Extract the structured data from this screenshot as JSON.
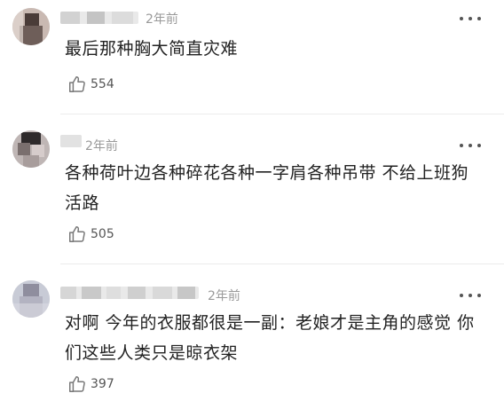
{
  "comments": [
    {
      "time": "2年前",
      "text": "最后那种胸大简直灾难",
      "likes": "554",
      "icons": {
        "like": "thumbs-up-icon",
        "more": "more-dots-icon"
      }
    },
    {
      "time": "2年前",
      "text": "各种荷叶边各种碎花各种一字肩各种吊带 不给上班狗活路",
      "likes": "505",
      "icons": {
        "like": "thumbs-up-icon",
        "more": "more-dots-icon"
      }
    },
    {
      "time": "2年前",
      "text": "对啊 今年的衣服都很是一副：老娘才是主角的感觉 你们这些人类只是晾衣架",
      "likes": "397",
      "icons": {
        "like": "thumbs-up-icon",
        "more": "more-dots-icon"
      }
    }
  ],
  "colors": {
    "text": "#222222",
    "muted": "#9a9a9a",
    "divider": "#ececec",
    "background": "#ffffff"
  }
}
